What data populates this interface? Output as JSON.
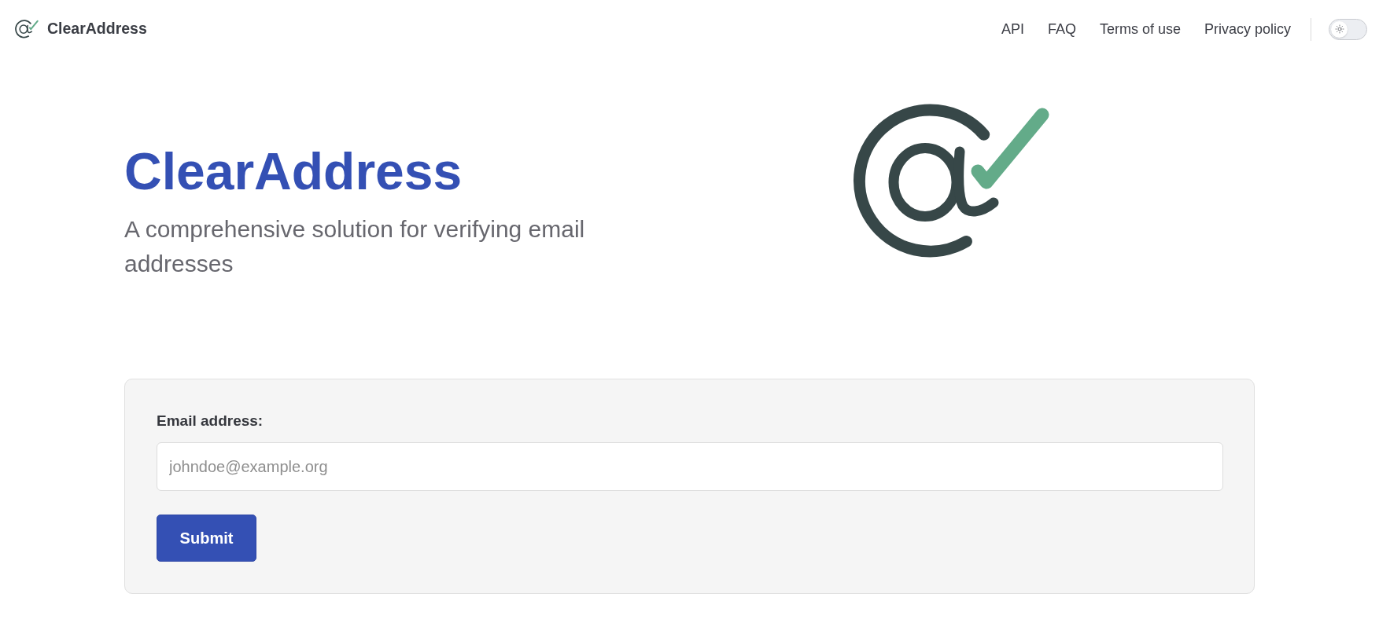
{
  "header": {
    "brand": "ClearAddress",
    "nav": [
      "API",
      "FAQ",
      "Terms of use",
      "Privacy policy"
    ],
    "theme_toggle": {
      "on": false
    }
  },
  "hero": {
    "title": "ClearAddress",
    "subtitle": "A comprehensive solution for verifying email addresses"
  },
  "form": {
    "label": "Email address:",
    "email_field": {
      "placeholder": "johndoe@example.org"
    },
    "submit": "Submit"
  }
}
